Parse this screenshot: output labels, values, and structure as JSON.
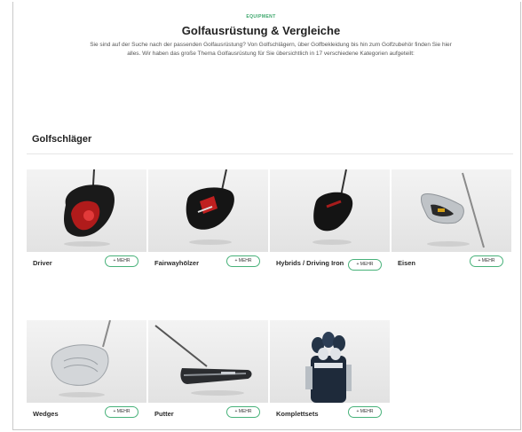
{
  "header": {
    "eyebrow": "EQUIPMENT",
    "title": "Golfausrüstung & Vergleiche",
    "intro": "Sie sind auf der Suche nach der passenden Golfausrüstung? Von Golfschlägern, über Golfbekleidung bis hin zum Golfzubehör finden Sie hier alles. Wir haben das große Thema Golfausrüstung für Sie übersichtlich in 17 verschiedene Kategorien aufgeteilt:"
  },
  "section": {
    "title": "Golfschläger"
  },
  "categories": [
    {
      "label": "Driver",
      "more": "+ MEHR",
      "image": "driver-club-image"
    },
    {
      "label": "Fairwayhölzer",
      "more": "+ MEHR",
      "image": "fairway-wood-image"
    },
    {
      "label": "Hybrids / Driving Iron",
      "more": "+ MEHR",
      "image": "hybrid-club-image"
    },
    {
      "label": "Eisen",
      "more": "+ MEHR",
      "image": "iron-club-image"
    },
    {
      "label": "Wedges",
      "more": "+ MEHR",
      "image": "wedge-club-image"
    },
    {
      "label": "Putter",
      "more": "+ MEHR",
      "image": "putter-image"
    },
    {
      "label": "Komplettsets",
      "more": "+ MEHR",
      "image": "golf-bag-set-image"
    }
  ],
  "colors": {
    "accent": "#48b27a",
    "eyebrow": "#3aa66a"
  }
}
